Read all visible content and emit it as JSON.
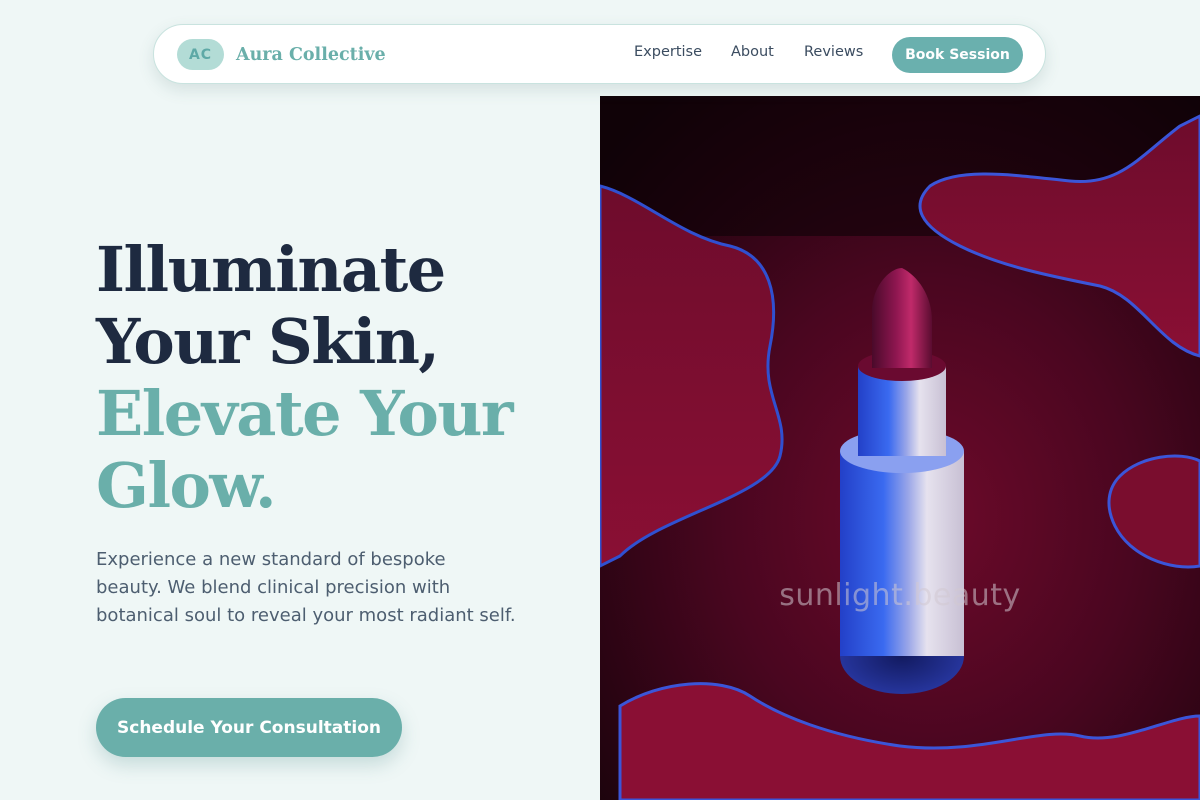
{
  "navbar": {
    "brand_initials": "AC",
    "brand_name": "Aura Collective",
    "links": [
      {
        "label": "Expertise"
      },
      {
        "label": "About"
      },
      {
        "label": "Reviews"
      }
    ],
    "book_button_label": "Book Session"
  },
  "hero": {
    "headline_lines": [
      "Illuminate",
      "Your Skin,",
      "Elevate Your",
      "Glow."
    ],
    "subtext": "Experience a new standard of bespoke beauty. We blend clinical precision with botanical soul to reveal your most radiant self.",
    "cta_label": "Schedule Your Consultation",
    "image_watermark": "sunlight.beauty"
  },
  "colors": {
    "background": "#eff7f6",
    "accent": "#6aafaa",
    "heading_dark": "#1e2a40",
    "body_text": "#4d5e70",
    "badge_bg": "#b3dcd6"
  },
  "image": {
    "subject": "lipstick-image"
  }
}
